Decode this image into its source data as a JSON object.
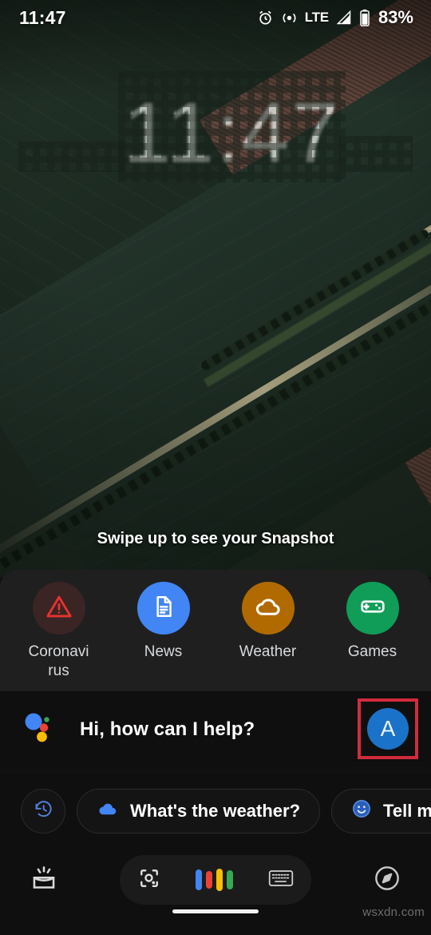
{
  "status_bar": {
    "time": "11:47",
    "battery_percent": "83%",
    "network_type": "LTE",
    "icons": [
      "alarm-icon",
      "cast-icon",
      "signal-icon",
      "battery-icon"
    ]
  },
  "lock_screen": {
    "date_text": "",
    "clock_text": "11:47",
    "sub_text": "",
    "swipe_hint": "Swipe up to see your Snapshot",
    "wallpaper_description": "aerial-farmland-photo"
  },
  "shortcuts": [
    {
      "label": "Coronavirus",
      "icon": "warning-triangle-icon",
      "circle_color": "#3a2424",
      "icon_color": "#e8332e"
    },
    {
      "label": "News",
      "icon": "document-icon",
      "circle_color": "#4285f4",
      "icon_color": "#ffffff"
    },
    {
      "label": "Weather",
      "icon": "cloud-icon",
      "circle_color": "#b06a00",
      "icon_color": "#ffffff"
    },
    {
      "label": "Games",
      "icon": "gamepad-icon",
      "circle_color": "#0f9d58",
      "icon_color": "#ffffff"
    }
  ],
  "assistant": {
    "greeting": "Hi, how can I help?",
    "logo": "google-assistant-icon",
    "avatar_letter": "A",
    "avatar_color": "#1a73c8",
    "highlight_color": "#d12b3c"
  },
  "suggestions": {
    "history_button_icon": "history-icon",
    "chips": [
      {
        "label": "What's the weather?",
        "icon": "cloud-icon",
        "icon_color": "#4285f4"
      },
      {
        "label": "Tell me",
        "icon": "smiley-icon",
        "icon_color": "#4285f4"
      }
    ]
  },
  "bottom_bar": {
    "snapshot_icon": "snapshot-tray-icon",
    "explore_icon": "compass-icon",
    "lens_icon": "google-lens-icon",
    "keyboard_icon": "keyboard-icon",
    "voice_bar_colors": [
      "#4285f4",
      "#ea4335",
      "#fbbc04",
      "#34a853"
    ]
  },
  "watermark": {
    "text": "wsxdn.com"
  }
}
